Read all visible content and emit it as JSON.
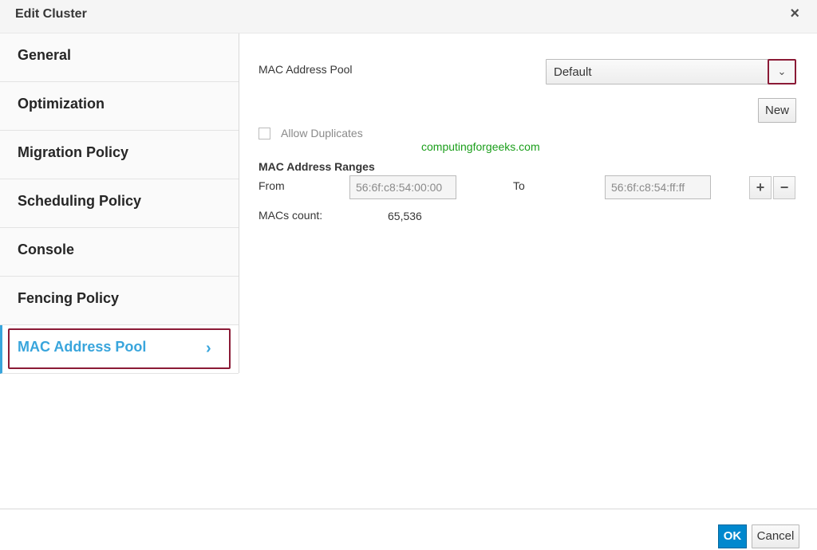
{
  "dialog": {
    "title": "Edit Cluster",
    "close_glyph": "×"
  },
  "sidebar": {
    "items": [
      {
        "label": "General"
      },
      {
        "label": "Optimization"
      },
      {
        "label": "Migration Policy"
      },
      {
        "label": "Scheduling Policy"
      },
      {
        "label": "Console"
      },
      {
        "label": "Fencing Policy"
      },
      {
        "label": "MAC Address Pool"
      }
    ],
    "active_index": 6,
    "active_chevron": "›"
  },
  "main": {
    "pool_label": "MAC Address Pool",
    "pool_select_value": "Default",
    "select_caret": "⌄",
    "new_button": "New",
    "allow_duplicates_label": "Allow Duplicates",
    "allow_duplicates_checked": false,
    "watermark": "computingforgeeks.com",
    "ranges_heading": "MAC Address Ranges",
    "from_label": "From",
    "from_value": "56:6f:c8:54:00:00",
    "to_label": "To",
    "to_value": "56:6f:c8:54:ff:ff",
    "add_glyph": "+",
    "remove_glyph": "−",
    "macs_count_label": "MACs count:",
    "macs_count_value": "65,536"
  },
  "footer": {
    "ok_label": "OK",
    "cancel_label": "Cancel"
  },
  "colors": {
    "accent": "#39a5dc",
    "primary_button": "#0088ce",
    "highlight_border": "#8b1a36",
    "watermark": "#1a9e1a"
  }
}
